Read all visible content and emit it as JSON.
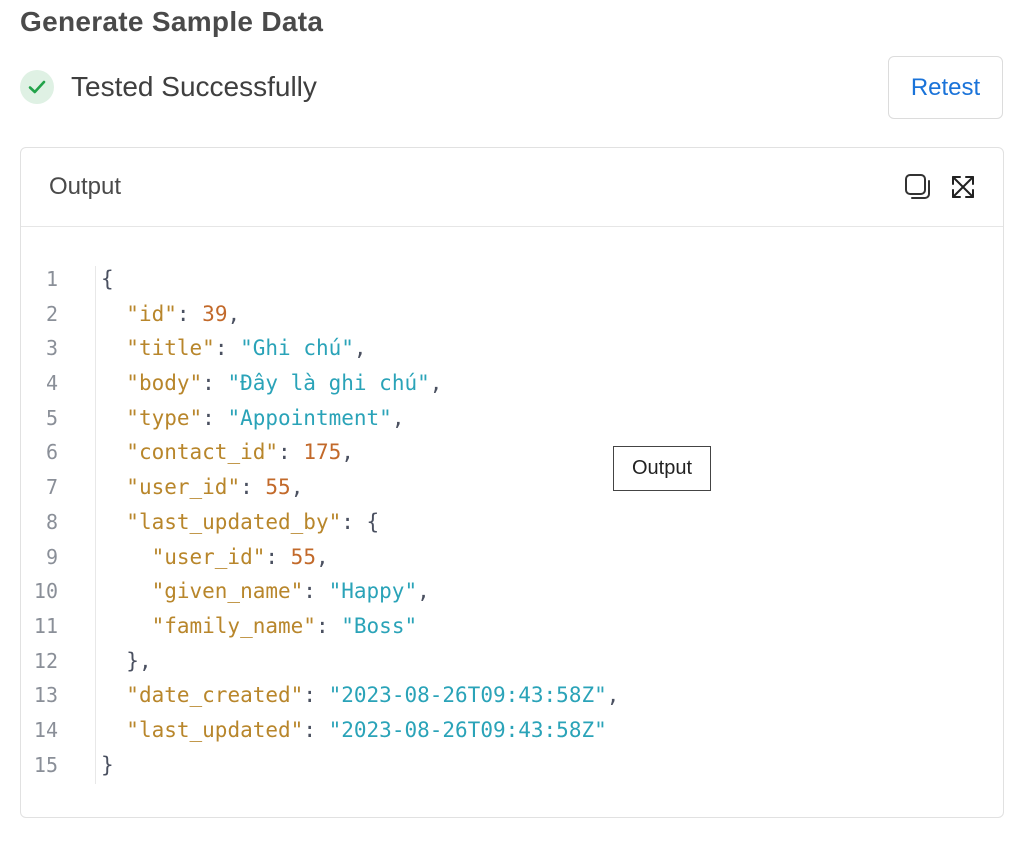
{
  "header": {
    "title": "Generate Sample Data"
  },
  "status": {
    "text": "Tested Successfully",
    "icon": "check-circle-icon",
    "color": "#22a34a"
  },
  "retest_button": {
    "label": "Retest",
    "color": "#1a73d9"
  },
  "output_panel": {
    "title": "Output",
    "copy_icon": "copy-icon",
    "expand_icon": "expand-icon",
    "tooltip": "Output"
  },
  "code": {
    "line_numbers": [
      "1",
      "2",
      "3",
      "4",
      "5",
      "6",
      "7",
      "8",
      "9",
      "10",
      "11",
      "12",
      "13",
      "14",
      "15"
    ],
    "tokens": {
      "l1": [
        "{"
      ],
      "l2": [
        "\"id\"",
        ": ",
        "39",
        ","
      ],
      "l3": [
        "\"title\"",
        ": ",
        "\"Ghi chú\"",
        ","
      ],
      "l4": [
        "\"body\"",
        ": ",
        "\"Đây là ghi chú\"",
        ","
      ],
      "l5": [
        "\"type\"",
        ": ",
        "\"Appointment\"",
        ","
      ],
      "l6": [
        "\"contact_id\"",
        ": ",
        "175",
        ","
      ],
      "l7": [
        "\"user_id\"",
        ": ",
        "55",
        ","
      ],
      "l8": [
        "\"last_updated_by\"",
        ": {"
      ],
      "l9": [
        "\"user_id\"",
        ": ",
        "55",
        ","
      ],
      "l10": [
        "\"given_name\"",
        ": ",
        "\"Happy\"",
        ","
      ],
      "l11": [
        "\"family_name\"",
        ": ",
        "\"Boss\""
      ],
      "l12": [
        "},"
      ],
      "l13": [
        "\"date_created\"",
        ": ",
        "\"2023-08-26T09:43:58Z\"",
        ","
      ],
      "l14": [
        "\"last_updated\"",
        ": ",
        "\"2023-08-26T09:43:58Z\""
      ],
      "l15": [
        "}"
      ]
    }
  }
}
